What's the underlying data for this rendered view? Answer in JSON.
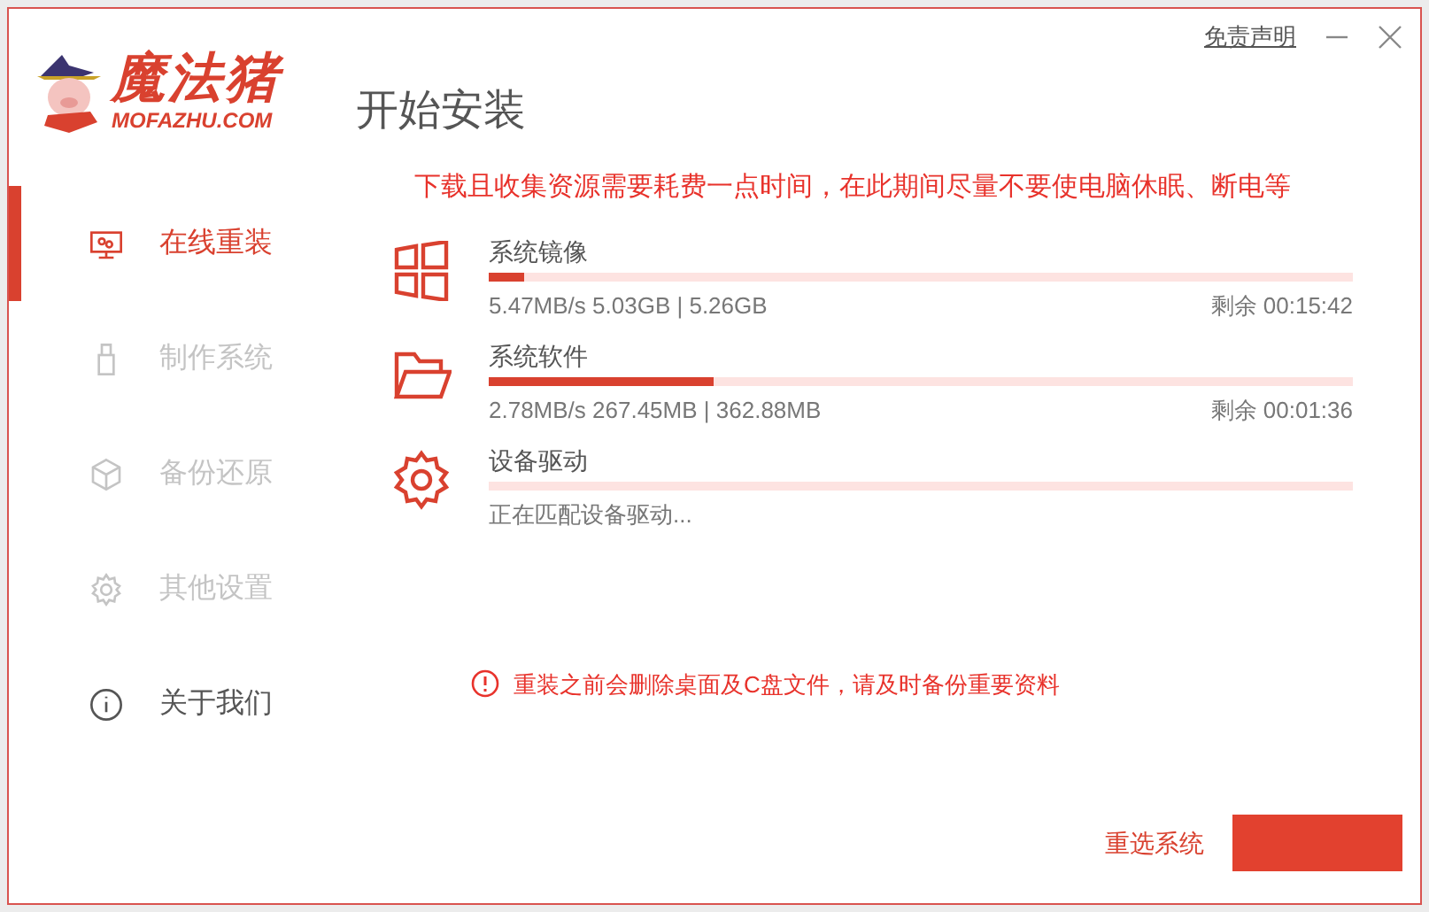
{
  "logo": {
    "name": "魔法猪",
    "domain": "MOFAZHU.COM"
  },
  "title": "开始安装",
  "disclaimer_link": "免责声明",
  "sidebar": {
    "items": [
      {
        "label": "在线重装",
        "kind": "monitor",
        "selected": true,
        "disabled": false
      },
      {
        "label": "制作系统",
        "kind": "usb",
        "selected": false,
        "disabled": true
      },
      {
        "label": "备份还原",
        "kind": "cube",
        "selected": false,
        "disabled": true
      },
      {
        "label": "其他设置",
        "kind": "gear",
        "selected": false,
        "disabled": true
      },
      {
        "label": "关于我们",
        "kind": "info",
        "selected": false,
        "disabled": false
      }
    ]
  },
  "notice": "下载且收集资源需要耗费一点时间，在此期间尽量不要使电脑休眠、断电等",
  "downloads": [
    {
      "kind": "windows",
      "name": "系统镜像",
      "level": 0.04,
      "status": "5.47MB/s 5.03GB | 5.26GB",
      "remaining": "剩余 00:15:42"
    },
    {
      "kind": "folder",
      "name": "系统软件",
      "level": 0.26,
      "status": "2.78MB/s 267.45MB | 362.88MB",
      "remaining": "剩余 00:01:36"
    },
    {
      "kind": "gear",
      "name": "设备驱动",
      "level": 0,
      "status": "正在匹配设备驱动..."
    }
  ],
  "warning": "重装之前会删除桌面及C盘文件，请及时备份重要资料",
  "buttons": [
    {
      "kind": "link",
      "label": "重选系统"
    },
    {
      "kind": "primary"
    }
  ]
}
